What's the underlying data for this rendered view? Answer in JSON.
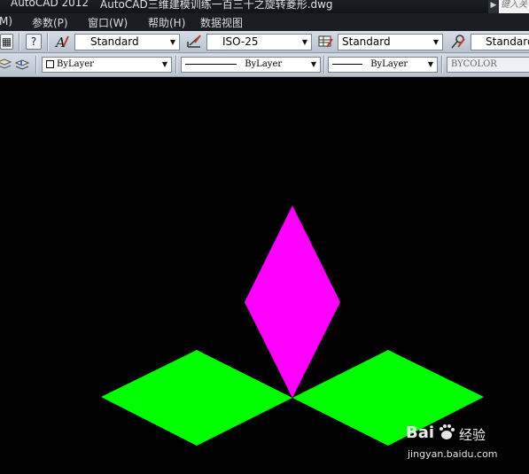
{
  "titlebar": {
    "app_name": "AutoCAD 2012",
    "document": "AutoCAD三维建模训练一百三十之旋转菱形.dwg",
    "search_placeholder": "键入关"
  },
  "menubar": {
    "items": [
      "M)",
      "参数(P)",
      "窗口(W)",
      "帮助(H)",
      "数据视图"
    ]
  },
  "toolbar_styles": {
    "text_style": "Standard",
    "dim_style": "ISO-25",
    "table_style": "Standard",
    "multileader_style": "Standard"
  },
  "toolbar_properties": {
    "layer": "ByLayer",
    "linetype": "ByLayer",
    "lineweight": "ByLayer",
    "plot_style": "BYCOLOR"
  },
  "drawing": {
    "background": "#000000",
    "shapes": [
      {
        "name": "upper-rhombus",
        "color": "#ff00ff"
      },
      {
        "name": "left-rhombus",
        "color": "#00ff00"
      },
      {
        "name": "right-rhombus",
        "color": "#00ff00"
      }
    ]
  },
  "watermark": {
    "brand": "Bai",
    "brand_cn": "经验",
    "url": "jingyan.baidu.com"
  }
}
